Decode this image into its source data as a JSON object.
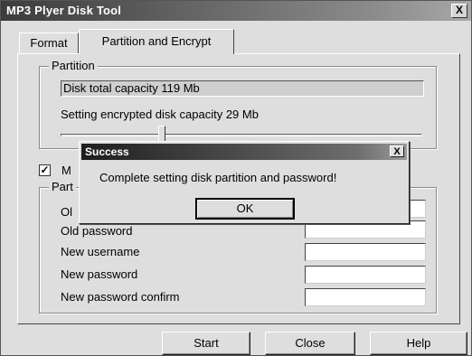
{
  "window": {
    "title": "MP3 Plyer Disk Tool",
    "close_glyph": "X"
  },
  "tabs": [
    {
      "label": "Format",
      "selected": false
    },
    {
      "label": "Partition and Encrypt",
      "selected": true
    }
  ],
  "partition": {
    "group_label": "Partition",
    "total_capacity_text": "Disk total capacity 119 Mb",
    "encrypted_capacity_label": "Setting encrypted disk capacity 29 Mb",
    "slider_fraction": 0.28
  },
  "checkbox": {
    "checked": true,
    "mark": "✓",
    "label_visible": "M"
  },
  "password_group": {
    "legend_visible": "Part",
    "fields": [
      {
        "label": "Ol",
        "value": ""
      },
      {
        "label": "Old password",
        "value": ""
      },
      {
        "label": "New username",
        "value": ""
      },
      {
        "label": "New password",
        "value": ""
      },
      {
        "label": "New password confirm",
        "value": ""
      }
    ]
  },
  "buttons": {
    "start": "Start",
    "close": "Close",
    "help": "Help"
  },
  "dialog": {
    "title": "Success",
    "close_glyph": "X",
    "message": "Complete setting disk partition and password!",
    "ok_label": "OK"
  }
}
